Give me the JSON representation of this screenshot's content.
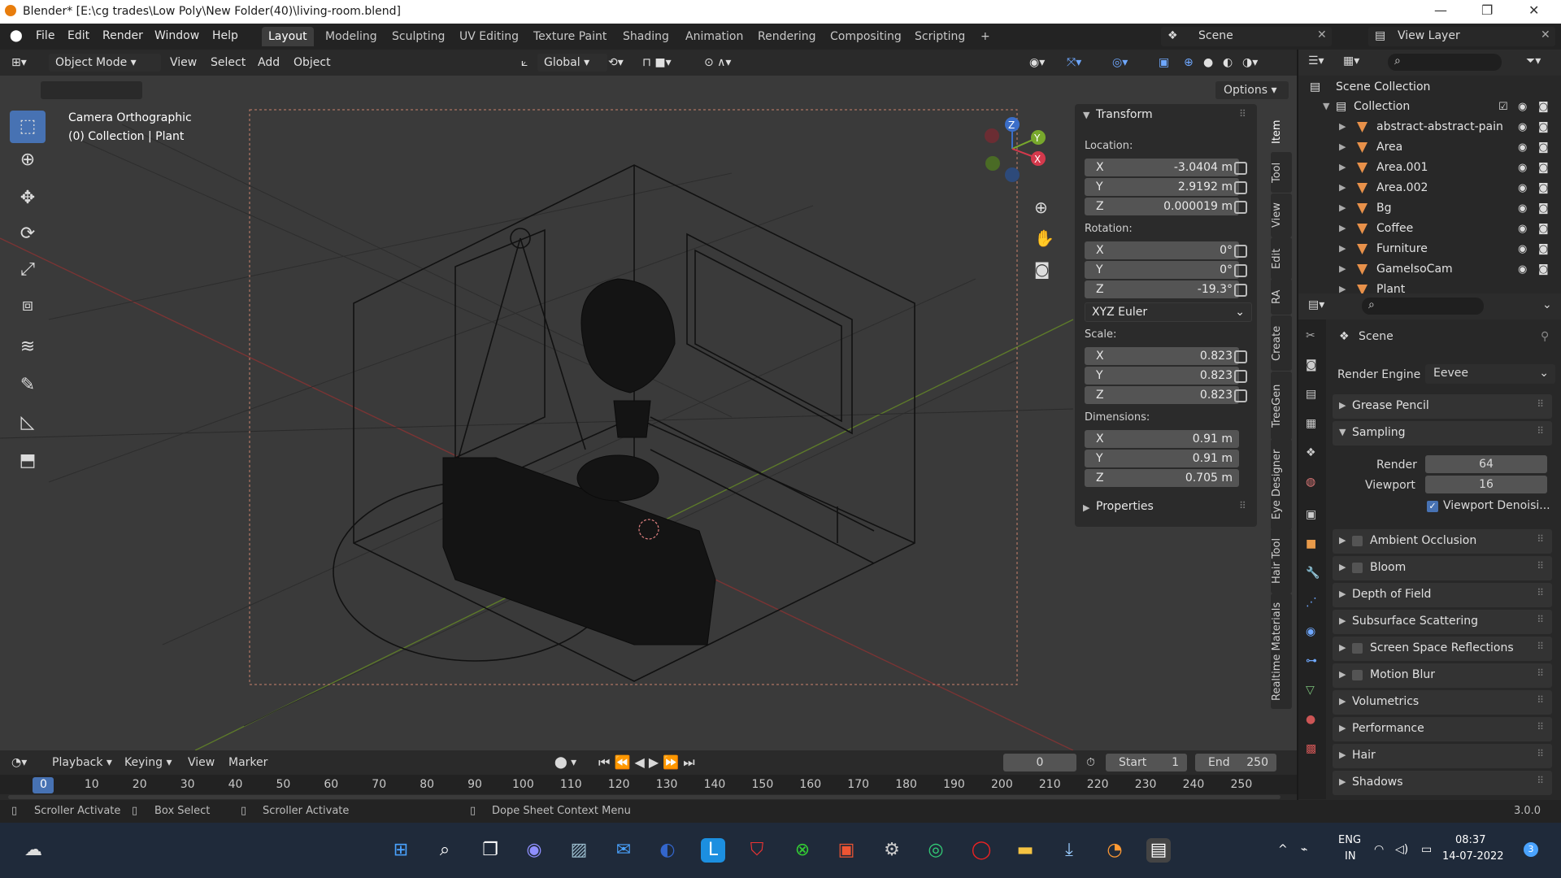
{
  "window": {
    "title": "Blender* [E:\\cg trades\\Low Poly\\New Folder(40)\\living-room.blend]"
  },
  "menu": [
    "File",
    "Edit",
    "Render",
    "Window",
    "Help"
  ],
  "workspaces": [
    "Layout",
    "Modeling",
    "Sculpting",
    "UV Editing",
    "Texture Paint",
    "Shading",
    "Animation",
    "Rendering",
    "Compositing",
    "Scripting"
  ],
  "active_workspace": "Layout",
  "scene_field": "Scene",
  "view_layer_field": "View Layer",
  "header": {
    "mode": "Object Mode",
    "menus": [
      "View",
      "Select",
      "Add",
      "Object"
    ],
    "orientation": "Global",
    "options": "Options"
  },
  "viewport": {
    "overlay_title": "Camera Orthographic",
    "overlay_sub": "(0) Collection | Plant",
    "gizmo_labels": {
      "x": "X",
      "y": "Y",
      "z": "Z"
    }
  },
  "npanel": {
    "section": "Transform",
    "location_label": "Location:",
    "location": [
      {
        "ax": "X",
        "v": "-3.0404 m"
      },
      {
        "ax": "Y",
        "v": "2.9192 m"
      },
      {
        "ax": "Z",
        "v": "0.000019 m"
      }
    ],
    "rotation_label": "Rotation:",
    "rotation": [
      {
        "ax": "X",
        "v": "0°"
      },
      {
        "ax": "Y",
        "v": "0°"
      },
      {
        "ax": "Z",
        "v": "-19.3°"
      }
    ],
    "rotation_mode": "XYZ Euler",
    "scale_label": "Scale:",
    "scale": [
      {
        "ax": "X",
        "v": "0.823"
      },
      {
        "ax": "Y",
        "v": "0.823"
      },
      {
        "ax": "Z",
        "v": "0.823"
      }
    ],
    "dimensions_label": "Dimensions:",
    "dimensions": [
      {
        "ax": "X",
        "v": "0.91 m"
      },
      {
        "ax": "Y",
        "v": "0.91 m"
      },
      {
        "ax": "Z",
        "v": "0.705 m"
      }
    ],
    "properties": "Properties"
  },
  "side_tabs": [
    "Item",
    "Tool",
    "View",
    "Edit",
    "RA",
    "Create",
    "TreeGen",
    "Eye Designer",
    "Hair Tool",
    "Realtime Materials"
  ],
  "outliner": {
    "scene_collection": "Scene Collection",
    "collection": "Collection",
    "items": [
      "abstract-abstract-pain",
      "Area",
      "Area.001",
      "Area.002",
      "Bg",
      "Coffee",
      "Furniture",
      "GameIsoCam",
      "Plant"
    ]
  },
  "properties": {
    "scene": "Scene",
    "render_engine_label": "Render Engine",
    "render_engine": "Eevee",
    "sections_top": [
      "Grease Pencil",
      "Sampling"
    ],
    "render_label": "Render",
    "render_samples": "64",
    "viewport_label": "Viewport",
    "viewport_samples": "16",
    "viewport_denoise": "Viewport Denoisi...",
    "sections": [
      {
        "label": "Ambient Occlusion",
        "cb": true
      },
      {
        "label": "Bloom",
        "cb": true
      },
      {
        "label": "Depth of Field",
        "cb": false
      },
      {
        "label": "Subsurface Scattering",
        "cb": false
      },
      {
        "label": "Screen Space Reflections",
        "cb": true
      },
      {
        "label": "Motion Blur",
        "cb": true
      },
      {
        "label": "Volumetrics",
        "cb": false
      },
      {
        "label": "Performance",
        "cb": false
      },
      {
        "label": "Hair",
        "cb": false
      },
      {
        "label": "Shadows",
        "cb": false
      }
    ]
  },
  "timeline": {
    "menus": [
      "Playback",
      "Keying",
      "View",
      "Marker"
    ],
    "current": "0",
    "start_label": "Start",
    "start": "1",
    "end_label": "End",
    "end": "250",
    "frames": [
      "0",
      "10",
      "20",
      "30",
      "40",
      "50",
      "60",
      "70",
      "80",
      "90",
      "100",
      "110",
      "120",
      "130",
      "140",
      "150",
      "160",
      "170",
      "180",
      "190",
      "200",
      "210",
      "220",
      "230",
      "240",
      "250"
    ]
  },
  "status": {
    "a": "Scroller Activate",
    "b": "Box Select",
    "c": "Scroller Activate",
    "d": "Dope Sheet Context Menu",
    "version": "3.0.0"
  },
  "taskbar": {
    "lang1": "ENG",
    "lang2": "IN",
    "time": "08:37",
    "date": "14-07-2022",
    "badge": "3"
  }
}
